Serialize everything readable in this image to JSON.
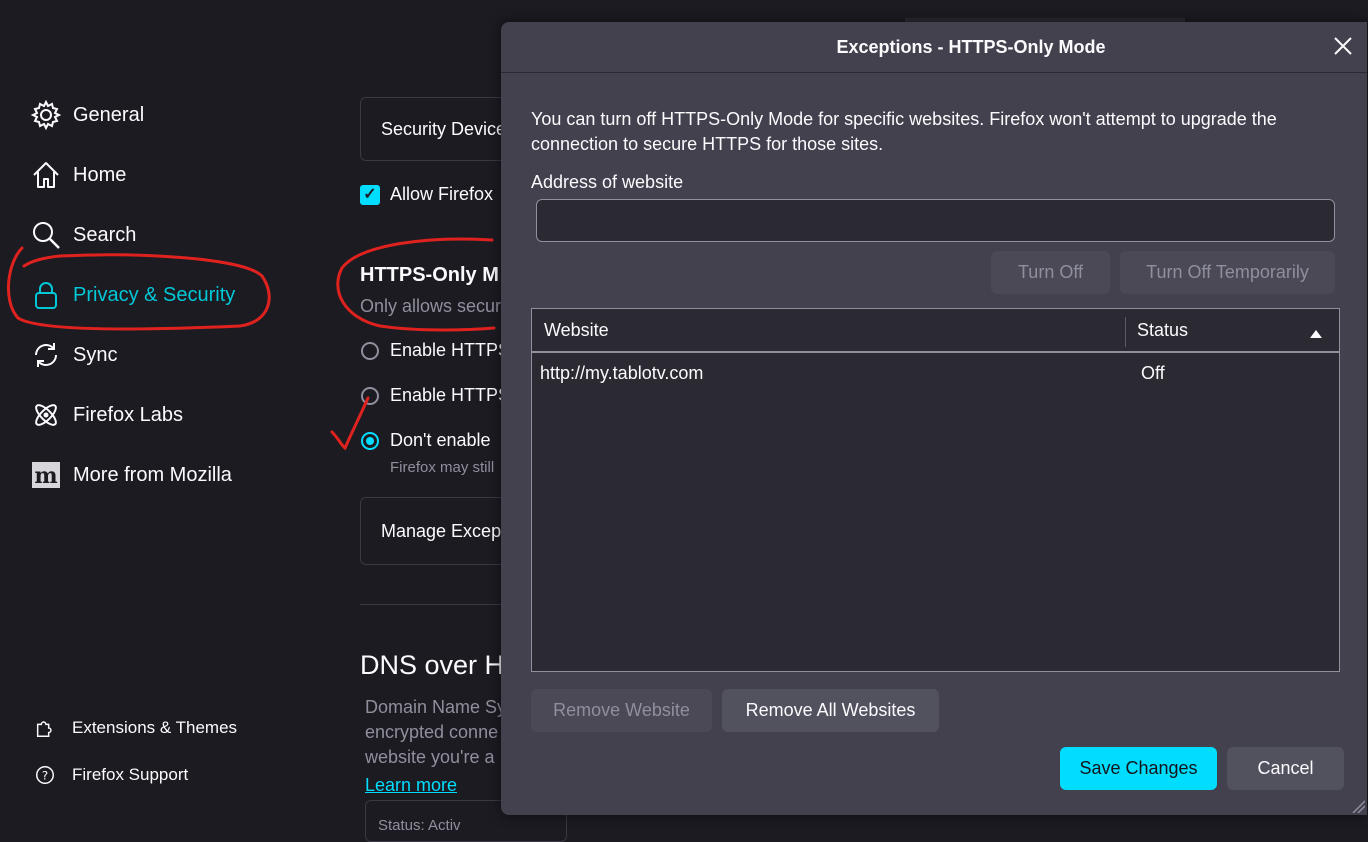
{
  "sidebar": {
    "items": [
      {
        "label": "General",
        "icon": "gear-icon"
      },
      {
        "label": "Home",
        "icon": "home-icon"
      },
      {
        "label": "Search",
        "icon": "search-icon"
      },
      {
        "label": "Privacy & Security",
        "icon": "lock-icon",
        "active": true
      },
      {
        "label": "Sync",
        "icon": "sync-icon"
      },
      {
        "label": "Firefox Labs",
        "icon": "atom-icon"
      },
      {
        "label": "More from Mozilla",
        "icon": "mozilla-icon"
      }
    ],
    "footer": [
      {
        "label": "Extensions & Themes",
        "icon": "puzzle-icon"
      },
      {
        "label": "Firefox Support",
        "icon": "help-icon"
      }
    ]
  },
  "main": {
    "security_devices_label": "Security Device",
    "allow_firefox_label": "Allow Firefox",
    "https_only_heading": "HTTPS-Only M",
    "https_only_desc": "Only allows secur",
    "radio_1": "Enable HTTPS",
    "radio_2": "Enable HTTPS",
    "radio_3": "Don't enable",
    "radio_3_note": "Firefox may still",
    "manage_exceptions_label": "Manage Excep",
    "dns_heading": "DNS over H",
    "dns_desc_1": "Domain Name Sy",
    "dns_desc_2": "encrypted conne",
    "dns_desc_3": "website you're a",
    "learn_more": "Learn more",
    "status_partial": "Status: Activ"
  },
  "dialog": {
    "title": "Exceptions - HTTPS-Only Mode",
    "description_1": "You can turn off HTTPS-Only Mode for specific websites. Firefox won't attempt to upgrade the",
    "description_2": "connection to secure HTTPS for those sites.",
    "address_label": "Address of website",
    "address_value": "",
    "turn_off_label": "Turn Off",
    "turn_off_temp_label": "Turn Off Temporarily",
    "columns": {
      "website": "Website",
      "status": "Status"
    },
    "rows": [
      {
        "website": "http://my.tablotv.com",
        "status": "Off"
      }
    ],
    "remove_website_label": "Remove Website",
    "remove_all_label": "Remove All Websites",
    "save_label": "Save Changes",
    "cancel_label": "Cancel"
  },
  "colors": {
    "accent": "#00ddff",
    "active_nav": "#00c8d7",
    "annotation": "#e0221f"
  }
}
